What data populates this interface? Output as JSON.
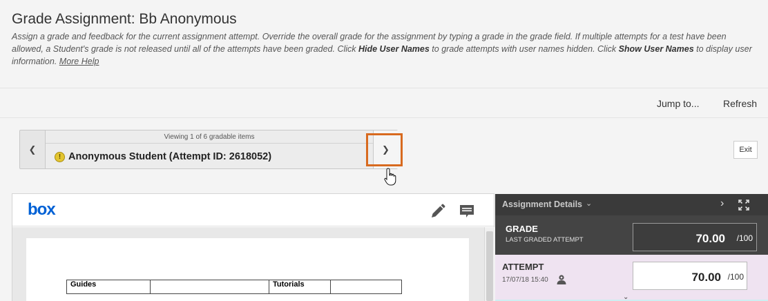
{
  "page": {
    "title": "Grade Assignment: Bb Anonymous",
    "help_part1": "Assign a grade and feedback for the current assignment attempt. Override the overall grade for the assignment by typing a grade in the grade field. If multiple attempts for a test have been allowed, a Student's grade is not released until all of the attempts have been graded. Click ",
    "help_bold1": "Hide User Names",
    "help_part2": " to grade attempts with user names hidden. Click ",
    "help_bold2": "Show User Names",
    "help_part3": " to display user information. ",
    "more_help": "More Help"
  },
  "toolbar": {
    "jump_to": "Jump to...",
    "refresh": "Refresh"
  },
  "navigator": {
    "viewing": "Viewing 1 of 6 gradable items",
    "student": "Anonymous Student (Attempt ID: 2618052)",
    "prev_icon": "chevron-left-icon",
    "next_icon": "chevron-right-icon"
  },
  "exit_label": "Exit",
  "viewer": {
    "logo": "box",
    "table_row": [
      "Guides",
      "",
      "Tutorials",
      ""
    ]
  },
  "panel": {
    "title": "Assignment Details",
    "grade_label": "GRADE",
    "grade_sub": "LAST GRADED ATTEMPT",
    "grade_value": "70.00",
    "grade_max": "/100",
    "attempt_label": "ATTEMPT",
    "attempt_date": "17/07/18 15:40",
    "attempt_value": "70.00",
    "attempt_max": "/100"
  },
  "colors": {
    "highlight": "#d86a1f",
    "box_brand": "#0061d5",
    "panel_dark": "#2a2a2a",
    "attempt_bg": "#efe3f1"
  }
}
